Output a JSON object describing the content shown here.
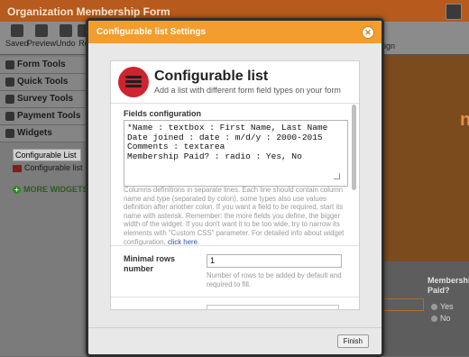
{
  "app": {
    "title": "Organization Membership Form"
  },
  "toolbar": {
    "items": [
      {
        "label": "Saved"
      },
      {
        "label": "Preview"
      },
      {
        "label": "Undo"
      },
      {
        "label": "Re"
      }
    ],
    "right_label": "bel Align"
  },
  "sidebar": {
    "items": [
      {
        "label": "Form Tools"
      },
      {
        "label": "Quick Tools"
      },
      {
        "label": "Survey Tools"
      },
      {
        "label": "Payment Tools"
      },
      {
        "label": "Widgets"
      }
    ],
    "widget_search_value": "Configurable List",
    "widget_result": "Configurable list",
    "more_widgets": "MORE WIDGETS"
  },
  "background": {
    "label": "Membership Paid?",
    "options": [
      "Yes",
      "No"
    ],
    "heading_fragment": "n"
  },
  "dialog": {
    "title": "Configurable list Settings",
    "close_glyph": "✕",
    "widget": {
      "name": "Configurable list",
      "description": "Add a list with different form field types on your form"
    },
    "fields_config": {
      "title": "Fields configuration",
      "value": "*Name : textbox : First Name, Last Name\nDate joined : date : m/d/y : 2000-2015\nComments : textarea\nMembership Paid? : radio : Yes, No",
      "help": "Columns definitions in separate lines. Each line should contain column name and type (separated by colon), some types also use values definition after another colon. If you want a field to be required, start its name with asterisk. Remember: the more fields you define, the bigger width of the widget. If you don't want it to be too wide, try to narrow its elements with \"Custom CSS\" parameter. For detailed info about widget configuration,",
      "help_link": "click here",
      "help_end": "."
    },
    "min_rows": {
      "label": "Minimal rows number",
      "value": "1",
      "help": "Number of rows to be added by default and required to fill."
    },
    "finish_label": "Finish"
  },
  "colors": {
    "dialog_header": "#f29d2d",
    "app_title_bar": "#b65a1d",
    "logo": "#cf2331",
    "link": "#2e4fb3"
  }
}
